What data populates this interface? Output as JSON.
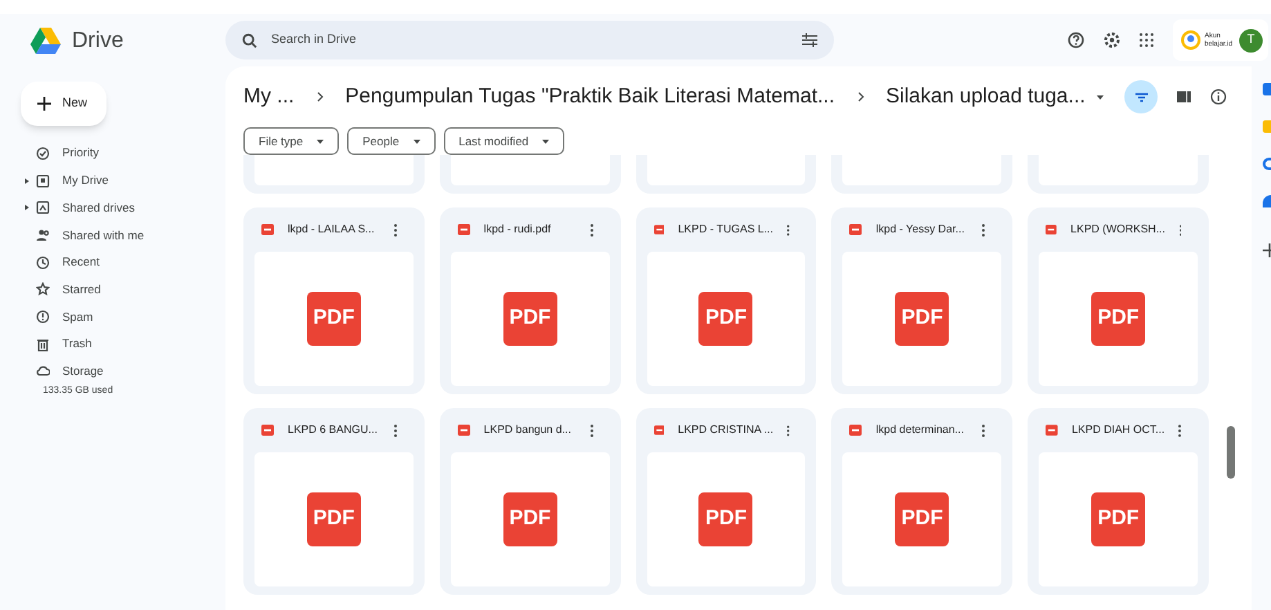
{
  "app": {
    "name": "Drive"
  },
  "search": {
    "placeholder": "Search in Drive"
  },
  "account": {
    "label": "Akun belajar.id",
    "avatar": "T"
  },
  "new_button": {
    "label": "New"
  },
  "sidebar": {
    "items": [
      {
        "label": "Priority",
        "expandable": false
      },
      {
        "label": "My Drive",
        "expandable": true
      },
      {
        "label": "Shared drives",
        "expandable": true
      },
      {
        "label": "Shared with me",
        "expandable": false
      },
      {
        "label": "Recent",
        "expandable": false
      },
      {
        "label": "Starred",
        "expandable": false
      },
      {
        "label": "Spam",
        "expandable": false
      },
      {
        "label": "Trash",
        "expandable": false
      },
      {
        "label": "Storage",
        "expandable": false
      }
    ],
    "storage_used": "133.35 GB used"
  },
  "breadcrumb": [
    {
      "label": "My ..."
    },
    {
      "label": "Pengumpulan Tugas \"Praktik Baik Literasi Matemat..."
    },
    {
      "label": "Silakan upload tuga..."
    }
  ],
  "filters": [
    {
      "label": "File type"
    },
    {
      "label": "People"
    },
    {
      "label": "Last modified"
    }
  ],
  "files": [
    {
      "name": "lkpd - LAILAA S...",
      "thumbnail": "PDF"
    },
    {
      "name": "lkpd - rudi.pdf",
      "thumbnail": "PDF"
    },
    {
      "name": "LKPD - TUGAS L...",
      "thumbnail": "PDF"
    },
    {
      "name": "lkpd - Yessy Dar...",
      "thumbnail": "PDF"
    },
    {
      "name": "LKPD (WORKSH...",
      "thumbnail": "PDF"
    },
    {
      "name": "LKPD 6 BANGU...",
      "thumbnail": "PDF"
    },
    {
      "name": "LKPD bangun d...",
      "thumbnail": "PDF"
    },
    {
      "name": "LKPD CRISTINA ...",
      "thumbnail": "PDF"
    },
    {
      "name": "lkpd determinan...",
      "thumbnail": "PDF"
    },
    {
      "name": "LKPD DIAH OCT...",
      "thumbnail": "PDF"
    }
  ]
}
